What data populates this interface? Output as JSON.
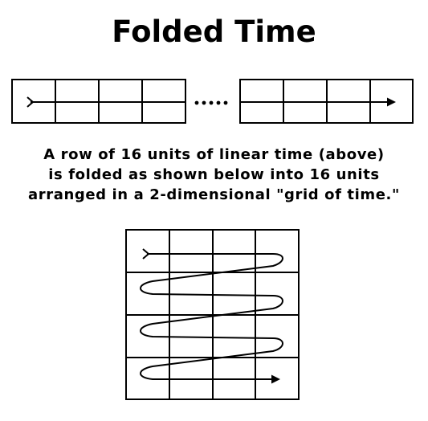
{
  "title": "Folded Time",
  "description": {
    "line1": "A row of 16 units of linear time (above)",
    "line2": "is folded as shown below into 16 units",
    "line3": "arranged in a 2-dimensional \"grid of time.\""
  },
  "linear_row": {
    "left_segment_units": 4,
    "right_segment_units": 4,
    "ellipsis_dots": 5
  },
  "folded_grid": {
    "rows": 4,
    "cols": 4
  },
  "colors": {
    "stroke": "#000000",
    "background": "#ffffff"
  }
}
